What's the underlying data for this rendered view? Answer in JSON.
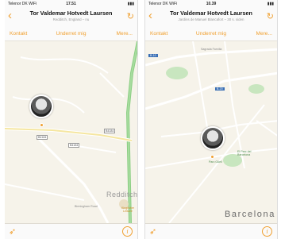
{
  "left": {
    "status": {
      "carrier": "Telenor DK WiFi",
      "time": "17.51"
    },
    "nav": {
      "title": "Tor Valdemar Hotvedt Laursen",
      "subtitle": "Redditch, England – nu"
    },
    "tabs": [
      "Kontakt",
      "Underret mig",
      "Mere..."
    ],
    "map": {
      "labels": [
        "B4184",
        "B4184",
        "B4184",
        "Redditch",
        "Birmingham Road",
        "Kingfisher Leisure"
      ]
    }
  },
  "right": {
    "status": {
      "carrier": "Telenor DK WiFi",
      "time": "10.39"
    },
    "nav": {
      "title": "Tor Valdemar Hotvedt Laursen",
      "subtitle": "Jardins de Manuel Blancafort – 30 s. siden"
    },
    "tabs": [
      "Kontakt",
      "Underret mig",
      "Mere..."
    ],
    "map": {
      "labels": [
        "B-10",
        "B-20",
        "Barcelona",
        "Sagrada Família",
        "El Parc del Barcelona",
        "Parc Güell"
      ]
    }
  },
  "colors": {
    "accent": "#f0a030",
    "map_bg": "#f6f3ea"
  },
  "icons": {
    "back": "chevron-left-icon",
    "refresh": "refresh-icon",
    "location": "location-arrow-icon",
    "info": "info-icon"
  }
}
